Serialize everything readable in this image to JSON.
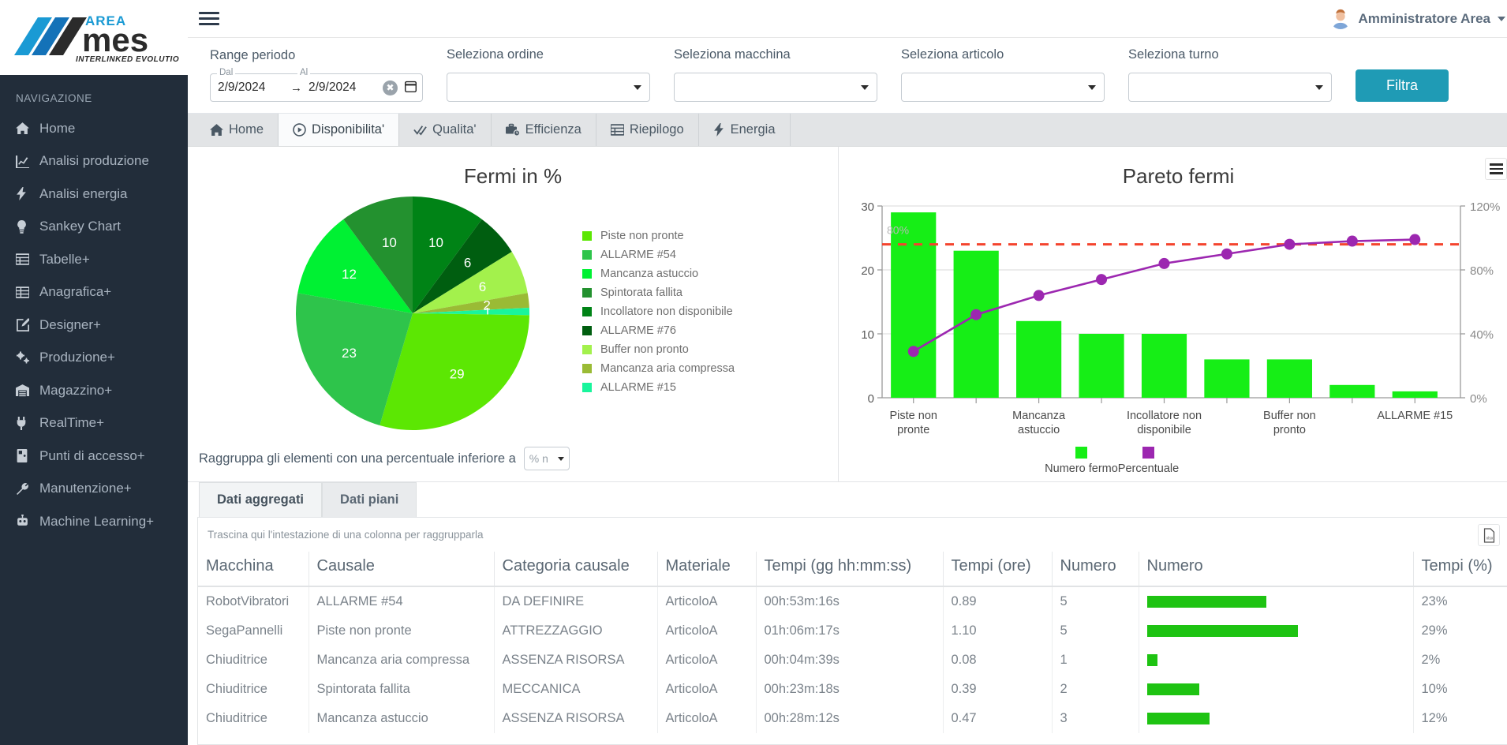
{
  "sidebar": {
    "logo_alt": "AREA mes INTERLINKED EVOLUTION",
    "nav_header": "NAVIGAZIONE",
    "items": [
      {
        "label": "Home",
        "icon": "home-icon"
      },
      {
        "label": "Analisi produzione",
        "icon": "chart-line-icon"
      },
      {
        "label": "Analisi energia",
        "icon": "bolt-icon"
      },
      {
        "label": "Sankey Chart",
        "icon": "lightbulb-icon"
      },
      {
        "label": "Tabelle+",
        "icon": "table-icon"
      },
      {
        "label": "Anagrafica+",
        "icon": "table-list-icon"
      },
      {
        "label": "Designer+",
        "icon": "pen-square-icon"
      },
      {
        "label": "Produzione+",
        "icon": "gears-icon"
      },
      {
        "label": "Magazzino+",
        "icon": "warehouse-icon"
      },
      {
        "label": "RealTime+",
        "icon": "plug-icon"
      },
      {
        "label": "Punti di accesso+",
        "icon": "door-icon"
      },
      {
        "label": "Manutenzione+",
        "icon": "wrench-icon"
      },
      {
        "label": "Machine Learning+",
        "icon": "robot-icon"
      }
    ]
  },
  "topbar": {
    "menu_icon": "hamburger-icon",
    "user_name": "Amministratore Area",
    "user_caret": "chevron-down-icon"
  },
  "filters": {
    "period": {
      "title": "Range periodo",
      "from_label": "Dal",
      "to_label": "Al",
      "from_value": "2/9/2024",
      "to_value": "2/9/2024",
      "arrow": "→",
      "clear_icon": "clear-circle-icon",
      "calendar_icon": "calendar-icon"
    },
    "selects": [
      {
        "label": "Seleziona ordine",
        "value": ""
      },
      {
        "label": "Seleziona macchina",
        "value": ""
      },
      {
        "label": "Seleziona articolo",
        "value": ""
      },
      {
        "label": "Seleziona turno",
        "value": ""
      }
    ],
    "submit_label": "Filtra",
    "accent_color": "#1f9bb5"
  },
  "tabs": [
    {
      "label": "Home",
      "icon": "home-icon",
      "active": false
    },
    {
      "label": "Disponibilita'",
      "icon": "play-circle-icon",
      "active": true
    },
    {
      "label": "Qualita'",
      "icon": "check-double-icon",
      "active": false
    },
    {
      "label": "Efficienza",
      "icon": "briefcase-clock-icon",
      "active": false
    },
    {
      "label": "Riepilogo",
      "icon": "table-icon",
      "active": false
    },
    {
      "label": "Energia",
      "icon": "bolt-icon",
      "active": false
    }
  ],
  "group_control": {
    "label": "Raggruppa gli elementi con una percentuale inferiore a",
    "value": "% n",
    "caret": "chevron-down-icon"
  },
  "subtabs": [
    {
      "label": "Dati aggregati",
      "active": true
    },
    {
      "label": "Dati piani",
      "active": false
    }
  ],
  "grid": {
    "drag_hint": "Trascina qui l'intestazione di una colonna per raggrupparla",
    "export_icon": "xlsx-export-icon",
    "columns": [
      "Macchina",
      "Causale",
      "Categoria causale",
      "Materiale",
      "Tempi (gg hh:mm:ss)",
      "Tempi (ore)",
      "Numero",
      "Numero",
      "Tempi (%)"
    ],
    "rows": [
      {
        "macchina": "RobotVibratori",
        "causale": "ALLARME #54",
        "categoria": "DA DEFINIRE",
        "materiale": "ArticoloA",
        "tempi_hms": "00h:53m:16s",
        "tempi_ore": "0.89",
        "numero": "5",
        "bar_pct": 23,
        "tempi_pct": "23%"
      },
      {
        "macchina": "SegaPannelli",
        "causale": "Piste non pronte",
        "categoria": "ATTREZZAGGIO",
        "materiale": "ArticoloA",
        "tempi_hms": "01h:06m:17s",
        "tempi_ore": "1.10",
        "numero": "5",
        "bar_pct": 29,
        "tempi_pct": "29%"
      },
      {
        "macchina": "Chiuditrice",
        "causale": "Mancanza aria compressa",
        "categoria": "ASSENZA RISORSA",
        "materiale": "ArticoloA",
        "tempi_hms": "00h:04m:39s",
        "tempi_ore": "0.08",
        "numero": "1",
        "bar_pct": 2,
        "tempi_pct": "2%"
      },
      {
        "macchina": "Chiuditrice",
        "causale": "Spintorata fallita",
        "categoria": "MECCANICA",
        "materiale": "ArticoloA",
        "tempi_hms": "00h:23m:18s",
        "tempi_ore": "0.39",
        "numero": "2",
        "bar_pct": 10,
        "tempi_pct": "10%"
      },
      {
        "macchina": "Chiuditrice",
        "causale": "Mancanza astuccio",
        "categoria": "ASSENZA RISORSA",
        "materiale": "ArticoloA",
        "tempi_hms": "00h:28m:12s",
        "tempi_ore": "0.47",
        "numero": "3",
        "bar_pct": 12,
        "tempi_pct": "12%"
      }
    ]
  },
  "chart_data": [
    {
      "type": "pie",
      "title": "Fermi in %",
      "categories": [
        "Piste non pronte",
        "ALLARME #54",
        "Mancanza astuccio",
        "Spintorata fallita",
        "Incollatore non disponibile",
        "ALLARME #76",
        "Buffer non pronto",
        "Mancanza aria compressa",
        "ALLARME #15"
      ],
      "values": [
        29,
        23,
        12,
        10,
        10,
        6,
        6,
        2,
        1
      ],
      "colors": [
        "#5CE703",
        "#2EC44B",
        "#00F133",
        "#23912F",
        "#008316",
        "#005E10",
        "#A3F14C",
        "#9ABB35",
        "#19F59C"
      ],
      "legend_position": "right",
      "labels_shown": true
    },
    {
      "type": "bar",
      "title": "Pareto fermi",
      "categories": [
        "Piste non pronte",
        "ALLARME #54",
        "Mancanza astuccio",
        "Spintorata fallita",
        "Incollatore non disponibile",
        "ALLARME #76",
        "Buffer non pronto",
        "Mancanza aria compressa",
        "ALLARME #15"
      ],
      "series": [
        {
          "name": "Numero fermo",
          "type": "bar",
          "color": "#16EE16",
          "values": [
            29,
            23,
            12,
            10,
            10,
            6,
            6,
            2,
            1
          ]
        },
        {
          "name": "Percentuale",
          "type": "line",
          "color": "#9C27B0",
          "values": [
            29,
            52,
            64,
            74,
            84,
            90,
            96,
            98,
            99
          ]
        }
      ],
      "ylabel": "",
      "ylim": [
        0,
        30
      ],
      "yticks": [
        0,
        10,
        20,
        30
      ],
      "y2lim": [
        0,
        120
      ],
      "y2ticks": [
        "0%",
        "40%",
        "80%",
        "120%"
      ],
      "threshold": {
        "value": "80%",
        "color": "#F44336",
        "style": "dashed"
      },
      "xtick_labels_shown": [
        "Piste non pronte",
        "Mancanza astuccio",
        "Incollatore non disponibile",
        "Buffer non pronto",
        "ALLARME #15"
      ],
      "legend_position": "bottom",
      "menu_icon": "hamburger-menu-icon"
    }
  ]
}
